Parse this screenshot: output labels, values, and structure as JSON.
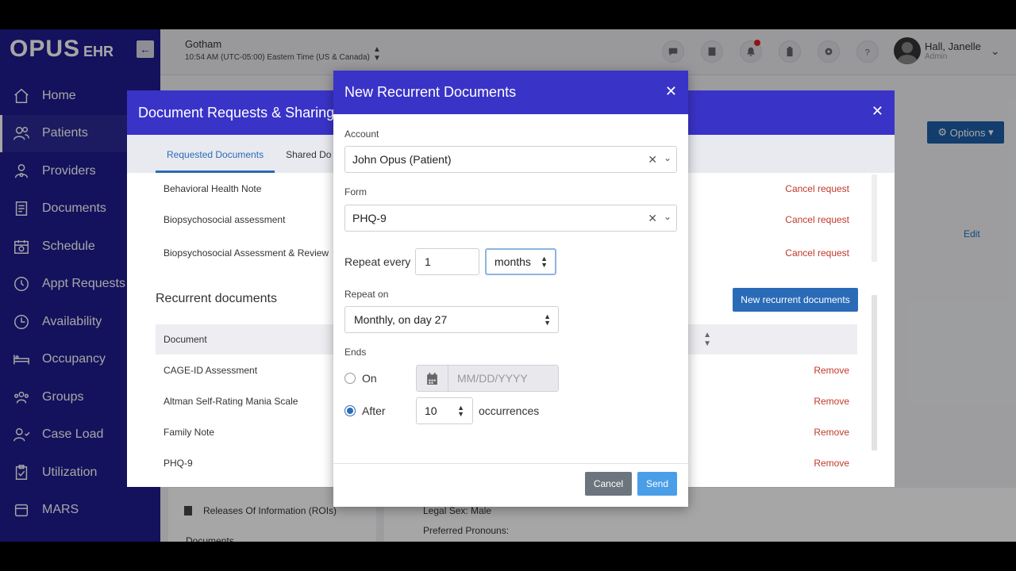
{
  "app": {
    "logo_main": "OPUS",
    "logo_sub": "EHR"
  },
  "sidebar": {
    "items": [
      {
        "label": "Home",
        "icon": "home-icon"
      },
      {
        "label": "Patients",
        "icon": "patients-icon"
      },
      {
        "label": "Providers",
        "icon": "providers-icon"
      },
      {
        "label": "Documents",
        "icon": "documents-icon"
      },
      {
        "label": "Schedule",
        "icon": "schedule-icon"
      },
      {
        "label": "Appt Requests",
        "icon": "clock-icon"
      },
      {
        "label": "Availability",
        "icon": "availability-icon"
      },
      {
        "label": "Occupancy",
        "icon": "bed-icon"
      },
      {
        "label": "Groups",
        "icon": "groups-icon"
      },
      {
        "label": "Case Load",
        "icon": "case-load-icon"
      },
      {
        "label": "Utilization",
        "icon": "clipboard-icon"
      },
      {
        "label": "MARS",
        "icon": "mars-icon"
      }
    ]
  },
  "header": {
    "location": "Gotham",
    "time": "10:54 AM (UTC-05:00) Eastern Time (US & Canada)",
    "user_name": "Hall, Janelle",
    "user_role": "Admin"
  },
  "background": {
    "options_label": "Options",
    "edit_label": "Edit",
    "roi_label": "Releases Of Information (ROIs)",
    "documents_label": "Documents",
    "legal_sex": "Legal Sex: Male",
    "pronouns": "Preferred Pronouns:"
  },
  "doc_modal": {
    "title": "Document Requests & Sharing",
    "tabs": [
      "Requested Documents",
      "Shared Do"
    ],
    "requested": [
      {
        "name": "Behavioral Health Note",
        "action": "Cancel request"
      },
      {
        "name": "Biopsychosocial assessment",
        "action": "Cancel request"
      },
      {
        "name": "Biopsychosocial Assessment & Review",
        "action": "Cancel request"
      }
    ],
    "recurrent_title": "Recurrent documents",
    "new_recurrent_label": "New recurrent documents",
    "column_document": "Document",
    "recurrent": [
      {
        "name": "CAGE-ID Assessment",
        "action": "Remove"
      },
      {
        "name": "Altman Self-Rating Mania Scale",
        "action": "Remove"
      },
      {
        "name": "Family Note",
        "action": "Remove"
      },
      {
        "name": "PHQ-9",
        "action": "Remove"
      }
    ]
  },
  "recurrent_modal": {
    "title": "New Recurrent Documents",
    "account_label": "Account",
    "account_value": "John Opus (Patient)",
    "form_label": "Form",
    "form_value": "PHQ-9",
    "repeat_every_label": "Repeat every",
    "repeat_every_value": "1",
    "repeat_unit": "months",
    "repeat_on_label": "Repeat on",
    "repeat_on_value": "Monthly, on day 27",
    "ends_label": "Ends",
    "on_label": "On",
    "date_placeholder": "MM/DD/YYYY",
    "after_label": "After",
    "occurrences_value": "10",
    "occurrences_label": "occurrences",
    "cancel_label": "Cancel",
    "send_label": "Send"
  },
  "colors": {
    "sidebar": "#1f1b8f",
    "modal_header": "#3a33c8",
    "primary": "#2a6bb8",
    "danger": "#c0392b"
  }
}
